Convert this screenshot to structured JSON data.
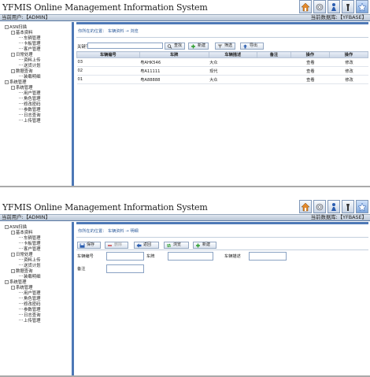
{
  "app": {
    "title": "YFMIS Online Management Information System",
    "user_label": "当前用户:【ADMIN】",
    "db_label": "当前数据库:【YFBASE】",
    "toolbar_icons": [
      "home-icon",
      "settings-icon",
      "user-icon",
      "help-icon",
      "star-icon"
    ]
  },
  "tree": [
    {
      "level": 0,
      "label": "ASN扫描",
      "toggle": "-"
    },
    {
      "level": 1,
      "label": "基本资料",
      "toggle": "-"
    },
    {
      "level": 2,
      "label": "车辆管理"
    },
    {
      "level": 2,
      "label": "卡板管理"
    },
    {
      "level": 2,
      "label": "客户管理"
    },
    {
      "level": 1,
      "label": "日常处理",
      "toggle": "-"
    },
    {
      "level": 2,
      "label": "资料上传"
    },
    {
      "level": 2,
      "label": "送货计划"
    },
    {
      "level": 1,
      "label": "数据查询",
      "toggle": "-"
    },
    {
      "level": 2,
      "label": "装载明细"
    },
    {
      "level": 0,
      "label": "系统管理",
      "toggle": "-"
    },
    {
      "level": 1,
      "label": "系统管理",
      "toggle": "-"
    },
    {
      "level": 2,
      "label": "用户管理"
    },
    {
      "level": 2,
      "label": "角色管理"
    },
    {
      "level": 2,
      "label": "修改密码"
    },
    {
      "level": 2,
      "label": "参数管理"
    },
    {
      "level": 2,
      "label": "日志查询"
    },
    {
      "level": 2,
      "label": "上传管理"
    }
  ],
  "list_view": {
    "breadcrumb": "你所在的位置： 车辆资料 → 浏览",
    "search_label": "关键字",
    "buttons": {
      "search": "查找",
      "new": "新建",
      "filter": "筛选",
      "export": "导出"
    },
    "columns": [
      "车辆编号",
      "车牌",
      "车辆描述",
      "备注",
      "操作",
      "操作"
    ],
    "rows": [
      {
        "id": "03",
        "plate": "粤AHK546",
        "desc": "大众",
        "note": "",
        "view": "查看",
        "edit": "修改"
      },
      {
        "id": "02",
        "plate": "粤A11111",
        "desc": "现代",
        "note": "",
        "view": "查看",
        "edit": "修改"
      },
      {
        "id": "01",
        "plate": "粤A88888",
        "desc": "大众",
        "note": "",
        "view": "查看",
        "edit": "修改"
      }
    ]
  },
  "detail_view": {
    "breadcrumb": "你所在的位置： 车辆资料 → 明细",
    "buttons": {
      "save": "保存",
      "delete": "删除",
      "back": "返回",
      "browse": "浏览",
      "new": "新建"
    },
    "fields": {
      "vehicle_no": "车辆编号",
      "plate": "车牌",
      "desc": "车辆描述",
      "note": "备注"
    },
    "values": {
      "vehicle_no": "",
      "plate": "",
      "desc": "",
      "note": ""
    }
  }
}
